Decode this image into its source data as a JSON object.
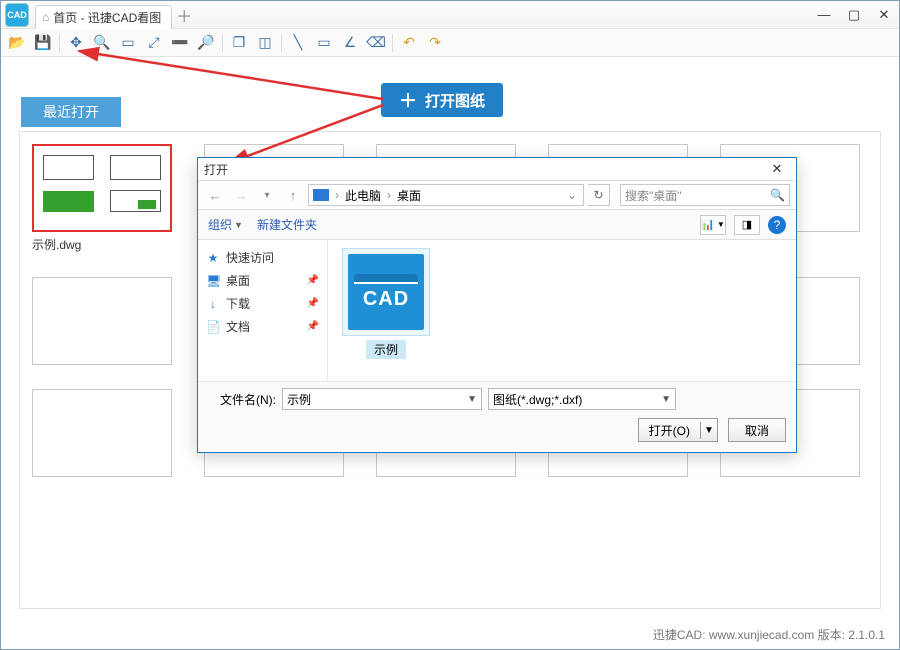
{
  "window": {
    "tab_title": "首页 - 迅捷CAD看图",
    "app_icon_text": "CAD"
  },
  "toolbar_icons": [
    "open-folder-icon",
    "save-icon",
    "sep",
    "pan-icon",
    "zoom-window-icon",
    "select-icon",
    "zoom-extent-icon",
    "zoom-out-icon",
    "zoom-realtime-icon",
    "sep",
    "model-3d-icon",
    "box-3d-icon",
    "sep",
    "measure-line-icon",
    "measure-rect-icon",
    "measure-angle-icon",
    "erase-icon",
    "sep",
    "undo-icon",
    "redo-icon"
  ],
  "big_open_label": "打开图纸",
  "recent": {
    "header": "最近打开",
    "items": [
      {
        "name": "示例.dwg",
        "selected": true
      }
    ],
    "placeholder_count": 14
  },
  "dialog": {
    "title": "打开",
    "breadcrumb": {
      "root": "此电脑",
      "folder": "桌面"
    },
    "search_placeholder": "搜索\"桌面\"",
    "toolbar": {
      "organize": "组织",
      "new_folder": "新建文件夹"
    },
    "tree": [
      {
        "icon": "star",
        "label": "快速访问",
        "color": "ic-blue"
      },
      {
        "icon": "desktop",
        "label": "桌面",
        "color": "ic-blue",
        "pinned": true
      },
      {
        "icon": "download",
        "label": "下载",
        "color": "ic-blue",
        "pinned": true
      },
      {
        "icon": "doc",
        "label": "文档",
        "color": "ic-gray",
        "pinned": true
      }
    ],
    "files": [
      {
        "name": "示例",
        "selected": true
      }
    ],
    "filename_label": "文件名(N):",
    "filename_value": "示例",
    "filter_value": "图纸(*.dwg;*.dxf)",
    "open_btn": "打开(O)",
    "cancel_btn": "取消"
  },
  "footer": {
    "brand": "迅捷CAD:",
    "url": "www.xunjiecad.com",
    "version_label": "版本:",
    "version": "2.1.0.1"
  }
}
